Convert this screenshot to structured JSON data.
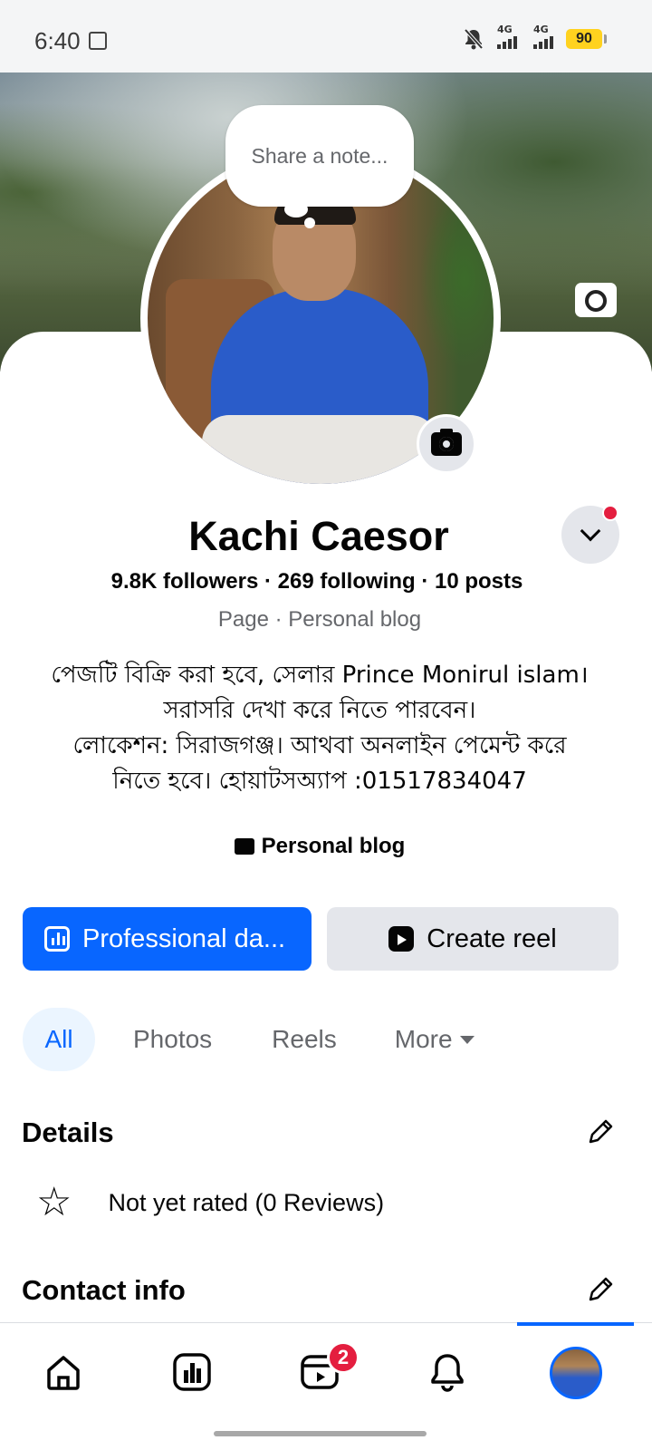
{
  "status_bar": {
    "time": "6:40",
    "network_1": "4G",
    "network_2": "4G",
    "battery": "90",
    "icons": [
      "screenshot-icon",
      "bell-muted-icon",
      "signal-icon",
      "battery-icon"
    ]
  },
  "profile": {
    "note_placeholder": "Share a note...",
    "name": "Kachi Caesor",
    "stats": "9.8K followers · 269 following · 10 posts",
    "category": "Page · Personal blog",
    "bio_lines": [
      "পেজটি বিক্রি করা হবে, সেলার Prince Monirul islam।",
      "সরাসরি দেখা করে নিতে পারবেন।",
      "লোকেশন: সিরাজগঞ্জ। আথবা অনলাইন পেমেন্ট করে",
      "নিতে হবে। হোয়াটসঅ্যাপ :01517834047"
    ],
    "blog_tag": "Personal blog"
  },
  "actions": {
    "professional_label": "Professional da...",
    "create_reel_label": "Create reel"
  },
  "tabs": {
    "all": "All",
    "photos": "Photos",
    "reels": "Reels",
    "more": "More"
  },
  "details": {
    "title": "Details",
    "rating_text": "Not yet rated (0 Reviews)"
  },
  "contact": {
    "title": "Contact info"
  },
  "bottom_nav": {
    "items": [
      "home-icon",
      "dashboard-icon",
      "video-icon",
      "notifications-icon",
      "profile-avatar"
    ],
    "video_badge": "2"
  },
  "colors": {
    "accent": "#0866ff",
    "badge": "#e41e3f",
    "secondary_button": "#e4e6eb",
    "muted_text": "#65676b"
  }
}
